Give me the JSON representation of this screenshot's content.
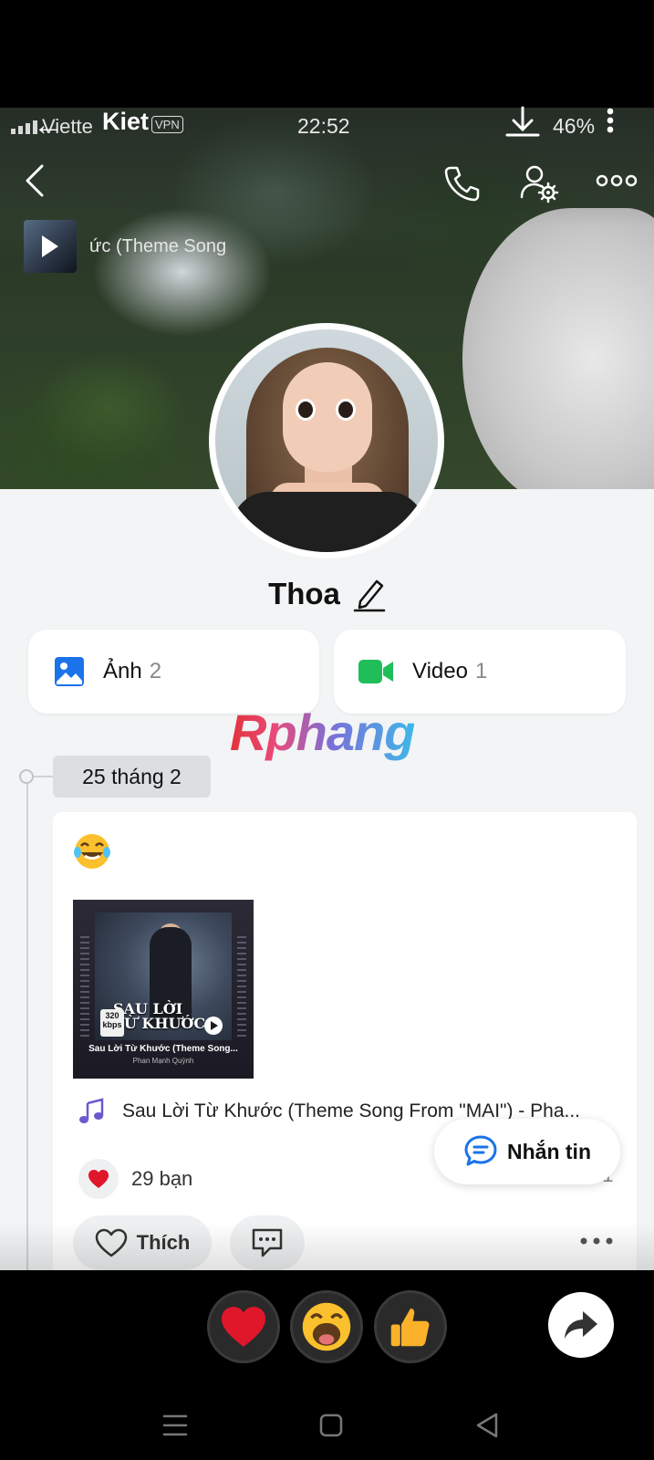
{
  "status_bar": {
    "carrier": "Viette",
    "overlay_name": "Kiet",
    "vpn": "VPN",
    "time": "22:52",
    "battery": "46%"
  },
  "music": {
    "pill_title": "ức (Theme Song"
  },
  "profile": {
    "name": "Thoa"
  },
  "media": {
    "photo_label": "Ảnh",
    "photo_count": "2",
    "video_label": "Video",
    "video_count": "1"
  },
  "watermark": "Rphang",
  "timeline": {
    "date": "25 tháng 2"
  },
  "post": {
    "emoji": "laughing-with-tears",
    "album": {
      "big_title_line1": "SAU LỜI",
      "big_title_line2": "TỪ KHƯỚC",
      "quality": "320 kbps",
      "caption": "Sau Lời Từ Khước (Theme Song...",
      "artist": "Phan Mạnh Quỳnh"
    },
    "song_title": "Sau Lời Từ Khước (Theme Song From \"MAI\") - Pha...",
    "reactions_count": "29 bạn",
    "comments_count": ".:1",
    "like_label": "Thích"
  },
  "message_button": "Nhắn tin",
  "colors": {
    "photo_icon": "#1a73e8",
    "video_icon": "#1fbe5a",
    "message_icon": "#1a73e8",
    "heart": "#e0162b",
    "background": "#f2f4f5"
  }
}
